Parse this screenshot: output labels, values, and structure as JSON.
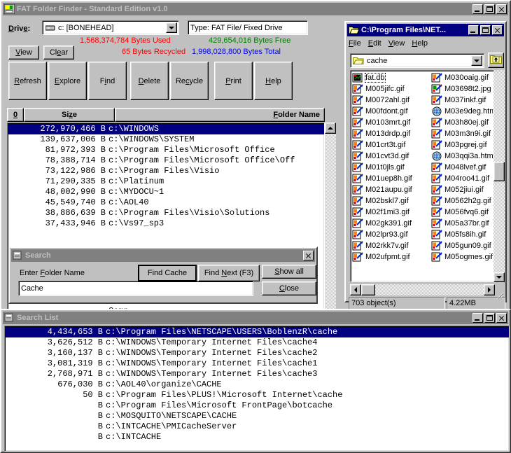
{
  "main_window": {
    "title": "FAT Folder Finder - Standard Edition v1.0",
    "icon": "fat-folder-finder-icon",
    "controls": {
      "minimize": "_",
      "maximize": "□",
      "close": "×"
    },
    "drive_label": "Drive:",
    "drive_value": "c: [BONEHEAD]",
    "type_value": "Type: FAT File/ Fixed Drive",
    "stats": {
      "used": "1,568,374,784 Bytes  Used",
      "used_color": "#ff0000",
      "free": "429,654,016 Bytes  Free",
      "free_color": "#008000",
      "recycled": "65 Bytes  Recycled",
      "recycled_color": "#ff0000",
      "total": "1,998,028,800 Bytes  Total",
      "total_color": "#0000ff"
    },
    "small_buttons": [
      {
        "label": "View",
        "accel": "V"
      },
      {
        "label": "Clear",
        "accel": "a"
      }
    ],
    "toolbar_buttons": [
      {
        "label": "Refresh",
        "accel": "R"
      },
      {
        "label": "Explore",
        "accel": "E"
      },
      {
        "label": "Find",
        "accel": "i"
      },
      {
        "label": "Delete",
        "accel": "D"
      },
      {
        "label": "Recycle",
        "accel": "c"
      },
      {
        "label": "Print",
        "accel": "P"
      },
      {
        "label": "Help",
        "accel": "H"
      }
    ],
    "columns": [
      {
        "label": "0",
        "accel": "0"
      },
      {
        "label": "Size",
        "accel": "z"
      },
      {
        "label": "Folder Name",
        "accel": "F"
      }
    ],
    "rows": [
      {
        "size": "272,970,466 B",
        "path": "c:\\WINDOWS",
        "selected": true
      },
      {
        "size": "139,637,006 B",
        "path": "c:\\WINDOWS\\SYSTEM",
        "selected": false
      },
      {
        "size": "81,972,393 B",
        "path": "c:\\Program Files\\Microsoft Office",
        "selected": false
      },
      {
        "size": "78,388,714 B",
        "path": "c:\\Program Files\\Microsoft Office\\Off",
        "selected": false
      },
      {
        "size": "73,122,986 B",
        "path": "c:\\Program Files\\Visio",
        "selected": false
      },
      {
        "size": "71,290,335 B",
        "path": "c:\\Platinum",
        "selected": false
      },
      {
        "size": "48,002,990 B",
        "path": "c:\\MYDOCU~1",
        "selected": false
      },
      {
        "size": "45,549,740 B",
        "path": "c:\\AOL40",
        "selected": false
      },
      {
        "size": "38,886,639 B",
        "path": "c:\\Program Files\\Visio\\Solutions",
        "selected": false
      },
      {
        "size": "37,433,946 B",
        "path": "c:\\Vs97_sp3",
        "selected": false
      }
    ],
    "partial_row_text": "Comp"
  },
  "explorer_window": {
    "title": "C:\\Program Files\\NET...",
    "icon": "open-folder-icon",
    "menu": [
      {
        "label": "File",
        "accel": "F"
      },
      {
        "label": "Edit",
        "accel": "E"
      },
      {
        "label": "View",
        "accel": "V"
      },
      {
        "label": "Help",
        "accel": "H"
      }
    ],
    "address_value": "cache",
    "up_button": "up-one-level-icon",
    "files_col1": [
      {
        "name": "fat.db",
        "icon": "db-file-icon",
        "focused": true
      },
      {
        "name": "M005jifc.gif",
        "icon": "gif-file-icon",
        "focused": false
      },
      {
        "name": "M0072ahl.gif",
        "icon": "gif-file-icon",
        "focused": false
      },
      {
        "name": "M00fdont.gif",
        "icon": "gif-file-icon",
        "focused": false
      },
      {
        "name": "M0103mrt.gif",
        "icon": "gif-file-icon",
        "focused": false
      },
      {
        "name": "M013drdp.gif",
        "icon": "gif-file-icon",
        "focused": false
      },
      {
        "name": "M01crt3t.gif",
        "icon": "gif-file-icon",
        "focused": false
      },
      {
        "name": "M01cvt3d.gif",
        "icon": "gif-file-icon",
        "focused": false
      },
      {
        "name": "M01t0jls.gif",
        "icon": "gif-file-icon",
        "focused": false
      },
      {
        "name": "M01uep8h.gif",
        "icon": "gif-file-icon",
        "focused": false
      },
      {
        "name": "M021aupu.gif",
        "icon": "gif-file-icon",
        "focused": false
      },
      {
        "name": "M02bskl7.gif",
        "icon": "gif-file-icon",
        "focused": false
      },
      {
        "name": "M02f1mi3.gif",
        "icon": "gif-file-icon",
        "focused": false
      },
      {
        "name": "M02gk391.gif",
        "icon": "gif-file-icon",
        "focused": false
      },
      {
        "name": "M02lpr93.gif",
        "icon": "gif-file-icon",
        "focused": false
      },
      {
        "name": "M02rkk7v.gif",
        "icon": "gif-file-icon",
        "focused": false
      },
      {
        "name": "M02ufpmt.gif",
        "icon": "gif-file-icon",
        "focused": false
      }
    ],
    "files_col2": [
      {
        "name": "M030oaig.gif",
        "icon": "gif-file-icon",
        "focused": false
      },
      {
        "name": "M03698t2.jpg",
        "icon": "jpg-file-icon",
        "focused": false
      },
      {
        "name": "M037inkf.gif",
        "icon": "gif-file-icon",
        "focused": false
      },
      {
        "name": "M03e9deg.htm",
        "icon": "html-file-icon",
        "focused": false
      },
      {
        "name": "M03h80ej.gif",
        "icon": "gif-file-icon",
        "focused": false
      },
      {
        "name": "M03m3n9i.gif",
        "icon": "gif-file-icon",
        "focused": false
      },
      {
        "name": "M03pgrej.gif",
        "icon": "gif-file-icon",
        "focused": false
      },
      {
        "name": "M03qqi3a.htm",
        "icon": "html-file-icon",
        "focused": false
      },
      {
        "name": "M048lvef.gif",
        "icon": "gif-file-icon",
        "focused": false
      },
      {
        "name": "M04roo41.gif",
        "icon": "gif-file-icon",
        "focused": false
      },
      {
        "name": "M052jiui.gif",
        "icon": "gif-file-icon",
        "focused": false
      },
      {
        "name": "M0562h2g.gif",
        "icon": "gif-file-icon",
        "focused": false
      },
      {
        "name": "M056fvq6.gif",
        "icon": "gif-file-icon",
        "focused": false
      },
      {
        "name": "M05a37br.gif",
        "icon": "gif-file-icon",
        "focused": false
      },
      {
        "name": "M05fs8ih.gif",
        "icon": "gif-file-icon",
        "focused": false
      },
      {
        "name": "M05gun09.gif",
        "icon": "gif-file-icon",
        "focused": false
      },
      {
        "name": "M05ogmes.gif",
        "icon": "gif-file-icon",
        "focused": false
      }
    ],
    "status": {
      "objects": "703 object(s)",
      "size": "4.22MB"
    }
  },
  "search_dialog": {
    "title": "Search",
    "icon": "search-window-icon",
    "close_glyph": "×",
    "prompt": "Enter Folder Name",
    "prompt_accel": "F",
    "input_value": "Cache",
    "buttons": [
      {
        "label": "Find Cache",
        "accel": ""
      },
      {
        "label": "Find Next (F3)",
        "accel": "N"
      },
      {
        "label": "Show all",
        "accel": "S"
      },
      {
        "label": "Close",
        "accel": "C"
      }
    ]
  },
  "search_list_window": {
    "title": "Search List",
    "icon": "search-list-icon",
    "controls": {
      "minimize": "_",
      "maximize": "□",
      "close": "×"
    },
    "rows": [
      {
        "size": "4,434,653 B",
        "path": "c:\\Program Files\\NETSCAPE\\USERS\\BoblenzR\\cache",
        "selected": true
      },
      {
        "size": "3,626,512 B",
        "path": "c:\\WINDOWS\\Temporary Internet Files\\cache4",
        "selected": false
      },
      {
        "size": "3,160,137 B",
        "path": "c:\\WINDOWS\\Temporary Internet Files\\cache2",
        "selected": false
      },
      {
        "size": "3,081,319 B",
        "path": "c:\\WINDOWS\\Temporary Internet Files\\cache1",
        "selected": false
      },
      {
        "size": "2,768,971 B",
        "path": "c:\\WINDOWS\\Temporary Internet Files\\cache3",
        "selected": false
      },
      {
        "size": "676,030 B",
        "path": "c:\\AOL40\\organize\\CACHE",
        "selected": false
      },
      {
        "size": "50 B",
        "path": "c:\\Program Files\\PLUS!\\Microsoft Internet\\cache",
        "selected": false
      },
      {
        "size": "B",
        "path": "c:\\Program Files\\Microsoft FrontPage\\botcache",
        "selected": false
      },
      {
        "size": "B",
        "path": "c:\\MOSQUITO\\NETSCAPE\\CACHE",
        "selected": false
      },
      {
        "size": "B",
        "path": "c:\\INTCACHE\\PMICacheServer",
        "selected": false
      },
      {
        "size": "B",
        "path": "c:\\INTCACHE",
        "selected": false
      }
    ]
  }
}
